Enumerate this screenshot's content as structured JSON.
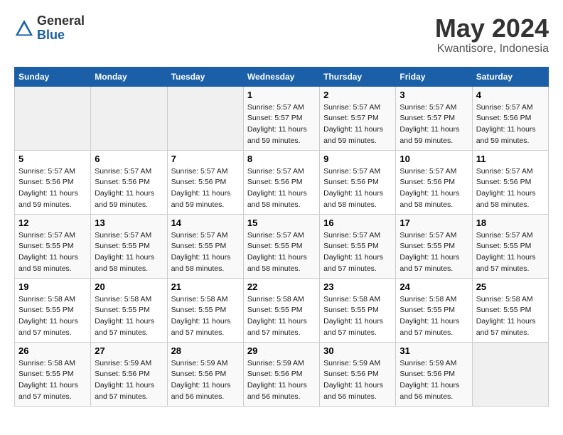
{
  "header": {
    "logo_general": "General",
    "logo_blue": "Blue",
    "title": "May 2024",
    "subtitle": "Kwantisore, Indonesia"
  },
  "weekdays": [
    "Sunday",
    "Monday",
    "Tuesday",
    "Wednesday",
    "Thursday",
    "Friday",
    "Saturday"
  ],
  "weeks": [
    {
      "days": [
        {
          "num": "",
          "info": ""
        },
        {
          "num": "",
          "info": ""
        },
        {
          "num": "",
          "info": ""
        },
        {
          "num": "1",
          "info": "Sunrise: 5:57 AM\nSunset: 5:57 PM\nDaylight: 11 hours\nand 59 minutes."
        },
        {
          "num": "2",
          "info": "Sunrise: 5:57 AM\nSunset: 5:57 PM\nDaylight: 11 hours\nand 59 minutes."
        },
        {
          "num": "3",
          "info": "Sunrise: 5:57 AM\nSunset: 5:57 PM\nDaylight: 11 hours\nand 59 minutes."
        },
        {
          "num": "4",
          "info": "Sunrise: 5:57 AM\nSunset: 5:56 PM\nDaylight: 11 hours\nand 59 minutes."
        }
      ]
    },
    {
      "days": [
        {
          "num": "5",
          "info": "Sunrise: 5:57 AM\nSunset: 5:56 PM\nDaylight: 11 hours\nand 59 minutes."
        },
        {
          "num": "6",
          "info": "Sunrise: 5:57 AM\nSunset: 5:56 PM\nDaylight: 11 hours\nand 59 minutes."
        },
        {
          "num": "7",
          "info": "Sunrise: 5:57 AM\nSunset: 5:56 PM\nDaylight: 11 hours\nand 59 minutes."
        },
        {
          "num": "8",
          "info": "Sunrise: 5:57 AM\nSunset: 5:56 PM\nDaylight: 11 hours\nand 58 minutes."
        },
        {
          "num": "9",
          "info": "Sunrise: 5:57 AM\nSunset: 5:56 PM\nDaylight: 11 hours\nand 58 minutes."
        },
        {
          "num": "10",
          "info": "Sunrise: 5:57 AM\nSunset: 5:56 PM\nDaylight: 11 hours\nand 58 minutes."
        },
        {
          "num": "11",
          "info": "Sunrise: 5:57 AM\nSunset: 5:56 PM\nDaylight: 11 hours\nand 58 minutes."
        }
      ]
    },
    {
      "days": [
        {
          "num": "12",
          "info": "Sunrise: 5:57 AM\nSunset: 5:55 PM\nDaylight: 11 hours\nand 58 minutes."
        },
        {
          "num": "13",
          "info": "Sunrise: 5:57 AM\nSunset: 5:55 PM\nDaylight: 11 hours\nand 58 minutes."
        },
        {
          "num": "14",
          "info": "Sunrise: 5:57 AM\nSunset: 5:55 PM\nDaylight: 11 hours\nand 58 minutes."
        },
        {
          "num": "15",
          "info": "Sunrise: 5:57 AM\nSunset: 5:55 PM\nDaylight: 11 hours\nand 58 minutes."
        },
        {
          "num": "16",
          "info": "Sunrise: 5:57 AM\nSunset: 5:55 PM\nDaylight: 11 hours\nand 57 minutes."
        },
        {
          "num": "17",
          "info": "Sunrise: 5:57 AM\nSunset: 5:55 PM\nDaylight: 11 hours\nand 57 minutes."
        },
        {
          "num": "18",
          "info": "Sunrise: 5:57 AM\nSunset: 5:55 PM\nDaylight: 11 hours\nand 57 minutes."
        }
      ]
    },
    {
      "days": [
        {
          "num": "19",
          "info": "Sunrise: 5:58 AM\nSunset: 5:55 PM\nDaylight: 11 hours\nand 57 minutes."
        },
        {
          "num": "20",
          "info": "Sunrise: 5:58 AM\nSunset: 5:55 PM\nDaylight: 11 hours\nand 57 minutes."
        },
        {
          "num": "21",
          "info": "Sunrise: 5:58 AM\nSunset: 5:55 PM\nDaylight: 11 hours\nand 57 minutes."
        },
        {
          "num": "22",
          "info": "Sunrise: 5:58 AM\nSunset: 5:55 PM\nDaylight: 11 hours\nand 57 minutes."
        },
        {
          "num": "23",
          "info": "Sunrise: 5:58 AM\nSunset: 5:55 PM\nDaylight: 11 hours\nand 57 minutes."
        },
        {
          "num": "24",
          "info": "Sunrise: 5:58 AM\nSunset: 5:55 PM\nDaylight: 11 hours\nand 57 minutes."
        },
        {
          "num": "25",
          "info": "Sunrise: 5:58 AM\nSunset: 5:55 PM\nDaylight: 11 hours\nand 57 minutes."
        }
      ]
    },
    {
      "days": [
        {
          "num": "26",
          "info": "Sunrise: 5:58 AM\nSunset: 5:55 PM\nDaylight: 11 hours\nand 57 minutes."
        },
        {
          "num": "27",
          "info": "Sunrise: 5:59 AM\nSunset: 5:56 PM\nDaylight: 11 hours\nand 57 minutes."
        },
        {
          "num": "28",
          "info": "Sunrise: 5:59 AM\nSunset: 5:56 PM\nDaylight: 11 hours\nand 56 minutes."
        },
        {
          "num": "29",
          "info": "Sunrise: 5:59 AM\nSunset: 5:56 PM\nDaylight: 11 hours\nand 56 minutes."
        },
        {
          "num": "30",
          "info": "Sunrise: 5:59 AM\nSunset: 5:56 PM\nDaylight: 11 hours\nand 56 minutes."
        },
        {
          "num": "31",
          "info": "Sunrise: 5:59 AM\nSunset: 5:56 PM\nDaylight: 11 hours\nand 56 minutes."
        },
        {
          "num": "",
          "info": ""
        }
      ]
    }
  ]
}
